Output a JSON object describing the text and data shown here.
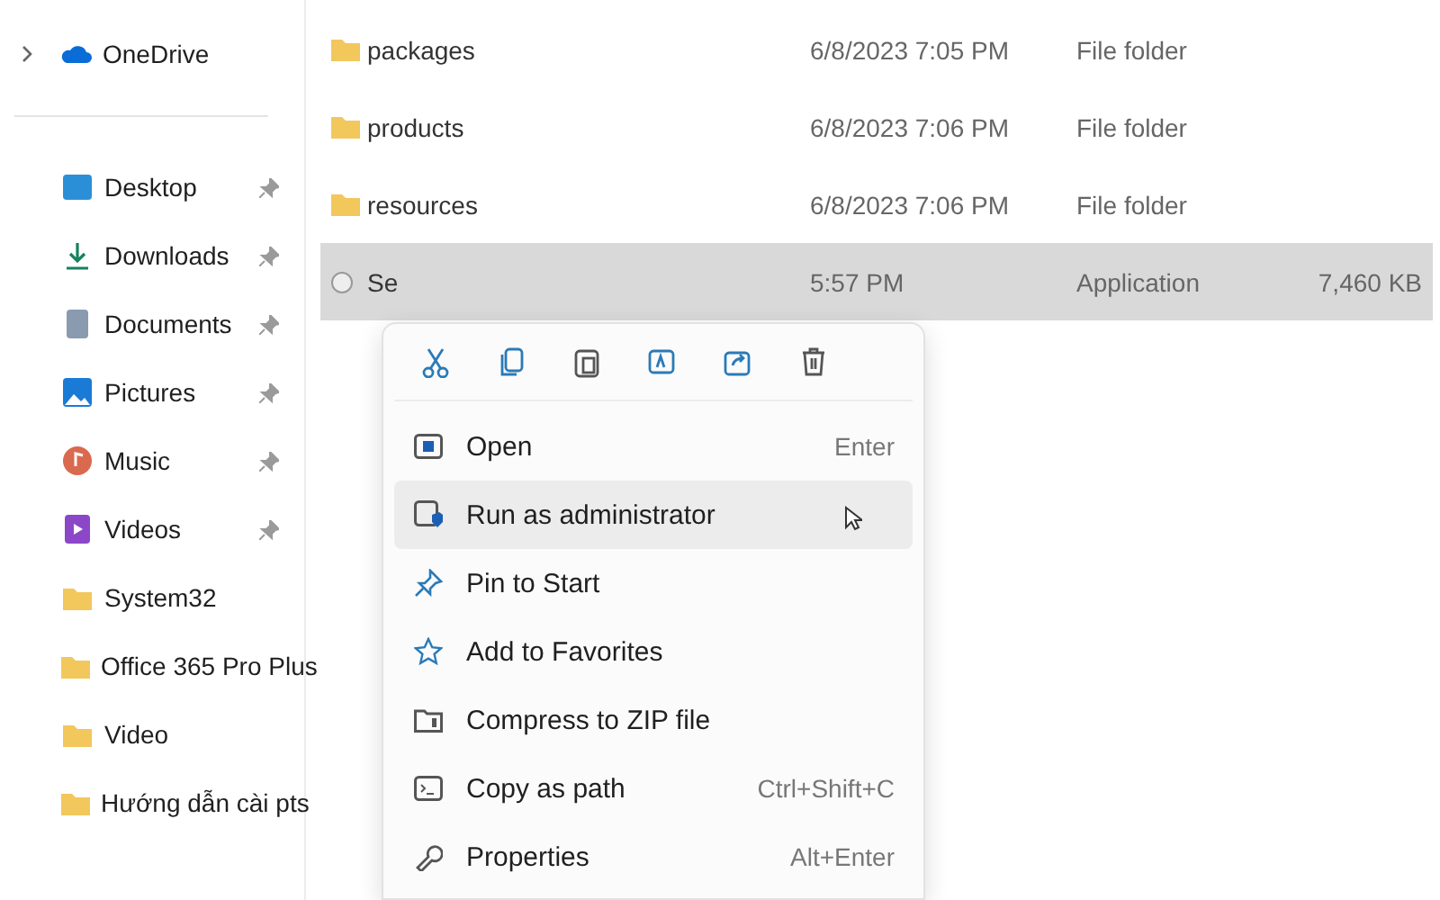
{
  "sidebar": {
    "items": [
      {
        "label": "OneDrive",
        "kind": "cloud",
        "expander": true,
        "pinned": false
      },
      {
        "label": "Desktop",
        "kind": "desktop",
        "expander": false,
        "pinned": true
      },
      {
        "label": "Downloads",
        "kind": "downloads",
        "expander": false,
        "pinned": true
      },
      {
        "label": "Documents",
        "kind": "documents",
        "expander": false,
        "pinned": true
      },
      {
        "label": "Pictures",
        "kind": "pictures",
        "expander": false,
        "pinned": true
      },
      {
        "label": "Music",
        "kind": "music",
        "expander": false,
        "pinned": true
      },
      {
        "label": "Videos",
        "kind": "videos",
        "expander": false,
        "pinned": true
      },
      {
        "label": "System32",
        "kind": "folder",
        "expander": false,
        "pinned": false
      },
      {
        "label": "Office 365 Pro Plus",
        "kind": "folder",
        "expander": false,
        "pinned": false
      },
      {
        "label": "Video",
        "kind": "folder",
        "expander": false,
        "pinned": false
      },
      {
        "label": "Hướng dẫn cài pts",
        "kind": "folder",
        "expander": false,
        "pinned": false
      }
    ]
  },
  "files": {
    "rows": [
      {
        "name": "packages",
        "date": "6/8/2023 7:05 PM",
        "type": "File folder",
        "kind": "folder",
        "selected": false
      },
      {
        "name": "products",
        "date": "6/8/2023 7:06 PM",
        "type": "File folder",
        "kind": "folder",
        "selected": false
      },
      {
        "name": "resources",
        "date": "6/8/2023 7:06 PM",
        "type": "File folder",
        "kind": "folder",
        "selected": false
      },
      {
        "name": "Se",
        "date": "5:57 PM",
        "type": "Application",
        "size": "7,460 KB",
        "kind": "app",
        "selected": true
      }
    ]
  },
  "context_menu": {
    "items": [
      {
        "label": "Open",
        "shortcut": "Enter",
        "kind": "open",
        "selected": false
      },
      {
        "label": "Run as administrator",
        "kind": "admin",
        "selected": true
      },
      {
        "label": "Pin to Start",
        "kind": "pin",
        "selected": false
      },
      {
        "label": "Add to Favorites",
        "kind": "star",
        "selected": false
      },
      {
        "label": "Compress to ZIP file",
        "kind": "zip",
        "selected": false
      },
      {
        "label": "Copy as path",
        "shortcut": "Ctrl+Shift+C",
        "kind": "path",
        "selected": false
      },
      {
        "label": "Properties",
        "shortcut": "Alt+Enter",
        "kind": "properties",
        "selected": false
      }
    ]
  }
}
